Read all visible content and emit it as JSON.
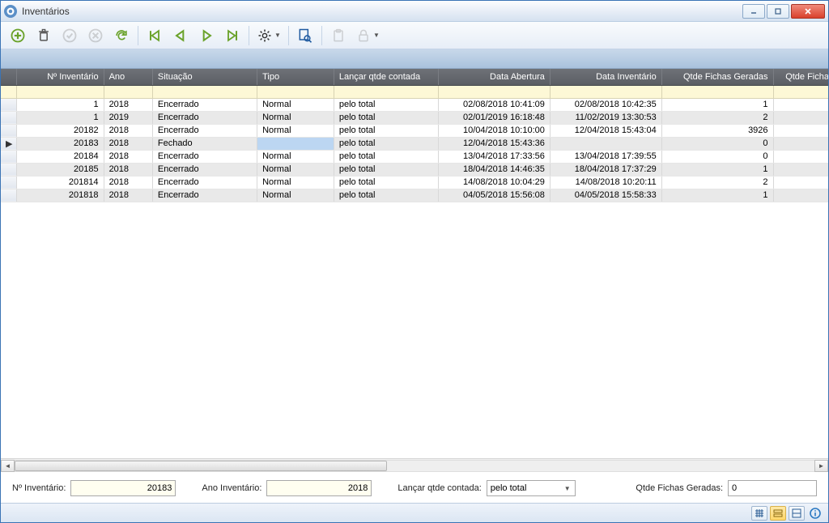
{
  "window": {
    "title": "Inventários"
  },
  "grid": {
    "headers": {
      "num": "Nº Inventário",
      "ano": "Ano",
      "situacao": "Situação",
      "tipo": "Tipo",
      "lancar": "Lançar qtde contada",
      "abertura": "Data Abertura",
      "inventario": "Data Inventário",
      "geradas": "Qtde Fichas Geradas",
      "fichas": "Qtde Ficha"
    },
    "rows": [
      {
        "num": "1",
        "ano": "2018",
        "situacao": "Encerrado",
        "tipo": "Normal",
        "lancar": "pelo total",
        "abertura": "02/08/2018 10:41:09",
        "inventario": "02/08/2018 10:42:35",
        "geradas": "1"
      },
      {
        "num": "1",
        "ano": "2019",
        "situacao": "Encerrado",
        "tipo": "Normal",
        "lancar": "pelo total",
        "abertura": "02/01/2019 16:18:48",
        "inventario": "11/02/2019 13:30:53",
        "geradas": "2"
      },
      {
        "num": "20182",
        "ano": "2018",
        "situacao": "Encerrado",
        "tipo": "Normal",
        "lancar": "pelo total",
        "abertura": "10/04/2018 10:10:00",
        "inventario": "12/04/2018 15:43:04",
        "geradas": "3926"
      },
      {
        "num": "20183",
        "ano": "2018",
        "situacao": "Fechado",
        "tipo": "",
        "lancar": "pelo total",
        "abertura": "12/04/2018 15:43:36",
        "inventario": "",
        "geradas": "0",
        "current": true
      },
      {
        "num": "20184",
        "ano": "2018",
        "situacao": "Encerrado",
        "tipo": "Normal",
        "lancar": "pelo total",
        "abertura": "13/04/2018 17:33:56",
        "inventario": "13/04/2018 17:39:55",
        "geradas": "0"
      },
      {
        "num": "20185",
        "ano": "2018",
        "situacao": "Encerrado",
        "tipo": "Normal",
        "lancar": "pelo total",
        "abertura": "18/04/2018 14:46:35",
        "inventario": "18/04/2018 17:37:29",
        "geradas": "1"
      },
      {
        "num": "201814",
        "ano": "2018",
        "situacao": "Encerrado",
        "tipo": "Normal",
        "lancar": "pelo total",
        "abertura": "14/08/2018 10:04:29",
        "inventario": "14/08/2018 10:20:11",
        "geradas": "2"
      },
      {
        "num": "201818",
        "ano": "2018",
        "situacao": "Encerrado",
        "tipo": "Normal",
        "lancar": "pelo total",
        "abertura": "04/05/2018 15:56:08",
        "inventario": "04/05/2018 15:58:33",
        "geradas": "1"
      }
    ]
  },
  "footer": {
    "num_label": "Nº Inventário:",
    "num_value": "20183",
    "ano_label": "Ano Inventário:",
    "ano_value": "2018",
    "lancar_label": "Lançar qtde contada:",
    "lancar_value": "pelo total",
    "geradas_label": "Qtde Fichas Geradas:",
    "geradas_value": "0"
  }
}
